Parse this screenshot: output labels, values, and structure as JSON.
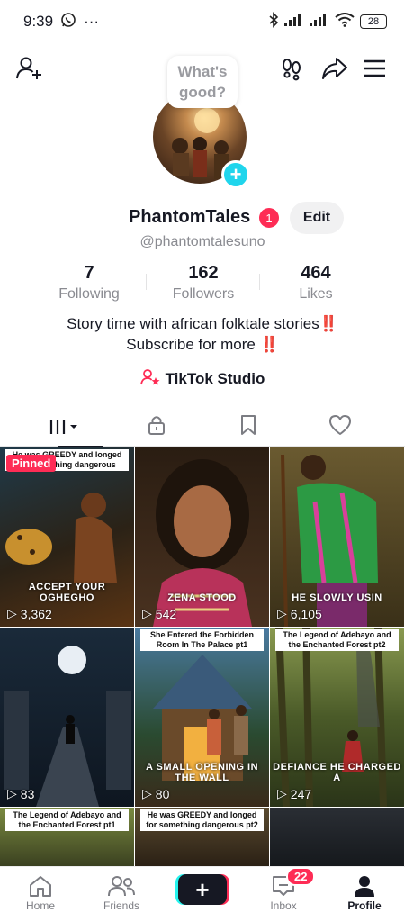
{
  "status_bar": {
    "time": "9:39",
    "battery": "28",
    "dots": "···"
  },
  "bubble": {
    "line1": "What's",
    "line2": "good?"
  },
  "profile": {
    "username": "PhantomTales",
    "notification_count": "1",
    "edit_label": "Edit",
    "handle": "@phantomtalesuno",
    "bio_line1": "Story time with african folktale stories",
    "bio_line1_mark": "‼️",
    "bio_line2": "Subscribe for more ",
    "bio_line2_mark": "‼️",
    "studio_label": "TikTok Studio"
  },
  "stats": [
    {
      "value": "7",
      "label": "Following"
    },
    {
      "value": "162",
      "label": "Followers"
    },
    {
      "value": "464",
      "label": "Likes"
    }
  ],
  "videos": [
    {
      "caption": "He was GREEDY and longed for something dangerous",
      "pinned": "Pinned",
      "overlay": "ACCEPT YOUR OGHEGHO",
      "views": "3,362"
    },
    {
      "caption": "",
      "overlay": "ZENA STOOD",
      "views": "542"
    },
    {
      "caption": "",
      "overlay": "HE SLOWLY USIN",
      "views": "6,105"
    },
    {
      "caption": "",
      "overlay": "",
      "views": "83"
    },
    {
      "caption": "She Entered the Forbidden Room In The Palace pt1",
      "overlay": "A SMALL OPENING IN THE WALL",
      "views": "80"
    },
    {
      "caption": "The Legend of Adebayo and the Enchanted Forest pt2",
      "overlay": "DEFIANCE HE CHARGED A",
      "views": "247"
    },
    {
      "caption": "The Legend of Adebayo and the Enchanted Forest pt1",
      "overlay": "",
      "views": ""
    },
    {
      "caption": "He was GREEDY and longed for something dangerous pt2",
      "overlay": "",
      "views": ""
    },
    {
      "caption": "",
      "overlay": "",
      "views": ""
    }
  ],
  "nav": {
    "home": "Home",
    "friends": "Friends",
    "create": "+",
    "inbox": "Inbox",
    "inbox_badge": "22",
    "profile": "Profile"
  },
  "colors": {
    "accent": "#fe2c55",
    "cyan": "#20d5ec",
    "text": "#161823",
    "muted": "#8a8b91"
  }
}
